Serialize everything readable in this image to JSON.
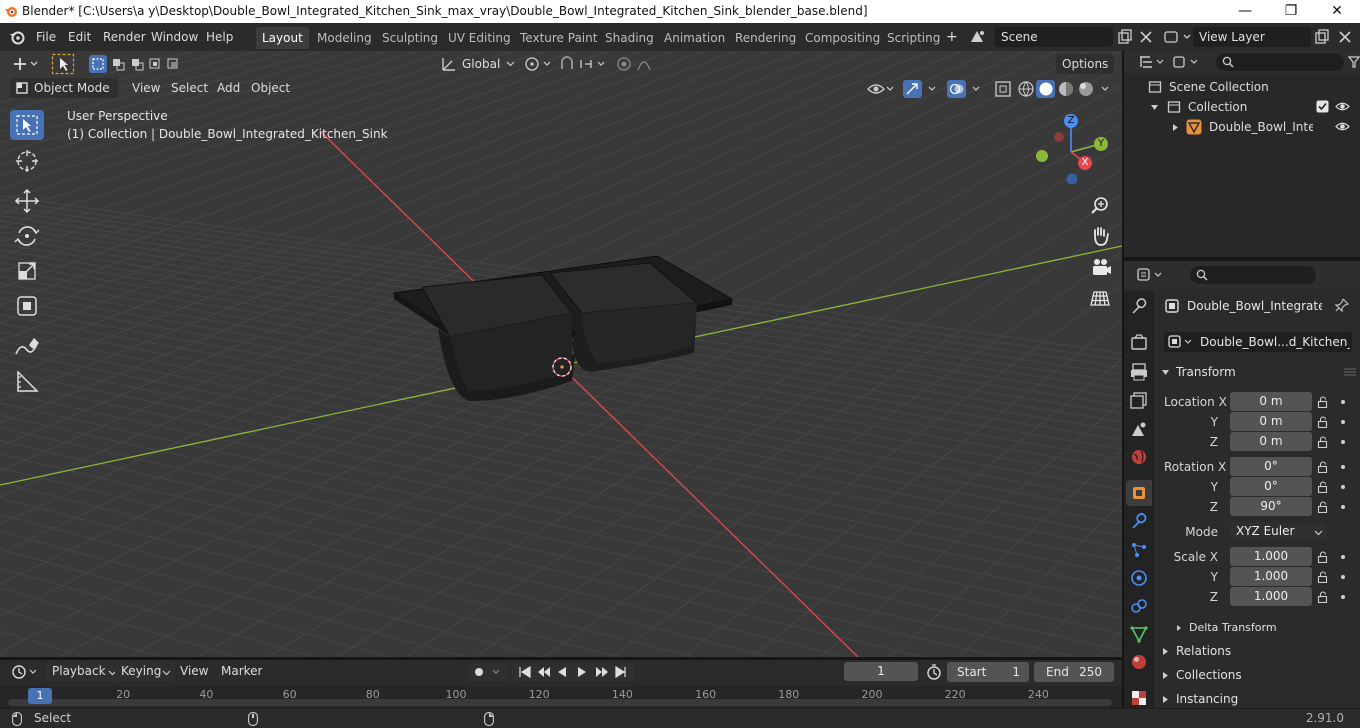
{
  "window": {
    "title": "Blender* [C:\\Users\\a y\\Desktop\\Double_Bowl_Integrated_Kitchen_Sink_max_vray\\Double_Bowl_Integrated_Kitchen_Sink_blender_base.blend]",
    "minimize": "—",
    "maximize": "❐",
    "close": "✕"
  },
  "menu": [
    "File",
    "Edit",
    "Render",
    "Window",
    "Help"
  ],
  "workspaces": [
    "Layout",
    "Modeling",
    "Sculpting",
    "UV Editing",
    "Texture Paint",
    "Shading",
    "Animation",
    "Rendering",
    "Compositing",
    "Scripting"
  ],
  "active_workspace": "Layout",
  "scene": "Scene",
  "view_layer": "View Layer",
  "toolbar": {
    "orientation": "Global",
    "options": "Options"
  },
  "viewport_header": {
    "mode": "Object Mode",
    "menus": [
      "View",
      "Select",
      "Add",
      "Object"
    ]
  },
  "overlay": {
    "perspective": "User Perspective",
    "collection_info": "(1) Collection | Double_Bowl_Integrated_Kitchen_Sink"
  },
  "gizmo": {
    "z": "Z",
    "y": "Y",
    "x": "X"
  },
  "outliner": {
    "scene_collection": "Scene Collection",
    "collection": "Collection",
    "object": "Double_Bowl_Integra"
  },
  "properties": {
    "object_name": "Double_Bowl_Integrated...",
    "data_name": "Double_Bowl...d_Kitchen_Sink",
    "transform_label": "Transform",
    "location": {
      "label": "Location X",
      "y_label": "Y",
      "z_label": "Z",
      "x": "0 m",
      "y": "0 m",
      "z": "0 m"
    },
    "rotation": {
      "label": "Rotation X",
      "y_label": "Y",
      "z_label": "Z",
      "x": "0°",
      "y": "0°",
      "z": "90°"
    },
    "mode_label": "Mode",
    "mode_value": "XYZ Euler",
    "scale": {
      "label": "Scale X",
      "y_label": "Y",
      "z_label": "Z",
      "x": "1.000",
      "y": "1.000",
      "z": "1.000"
    },
    "delta_transform": "Delta Transform",
    "relations": "Relations",
    "collections": "Collections",
    "instancing": "Instancing"
  },
  "timeline": {
    "menus": [
      "Playback",
      "Keying",
      "View",
      "Marker"
    ],
    "current_frame": "1",
    "start_label": "Start",
    "start": "1",
    "end_label": "End",
    "end": "250",
    "ruler": [
      "1",
      "20",
      "40",
      "60",
      "80",
      "100",
      "120",
      "140",
      "160",
      "180",
      "200",
      "220",
      "240"
    ]
  },
  "status": {
    "left": "Select",
    "version": "2.91.0"
  },
  "colors": {
    "accent": "#4772b3",
    "x_axis": "#e8484d",
    "y_axis": "#8bb83b",
    "z_axis": "#4b8ef7",
    "object_orange": "#e8913a"
  }
}
